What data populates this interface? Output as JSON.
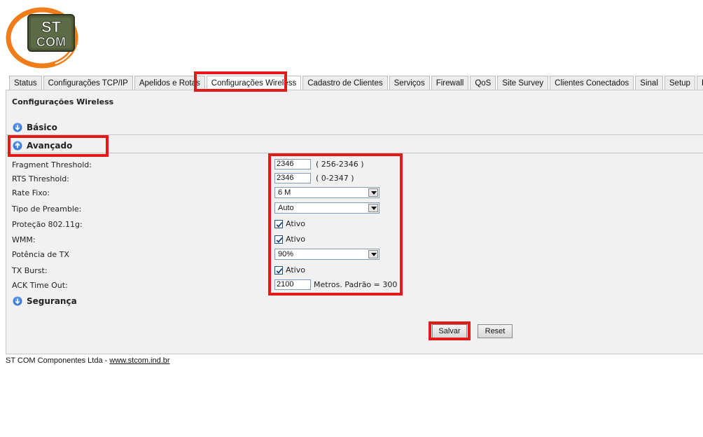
{
  "logo": {
    "line1": "ST",
    "line2": "COM",
    "ring_color": "#f07c1a",
    "box_color": "#4e5a3a"
  },
  "tabs": [
    {
      "label": "Status"
    },
    {
      "label": "Configurações TCP/IP"
    },
    {
      "label": "Apelidos e Rotas"
    },
    {
      "label": "Configurações Wireless",
      "active": true
    },
    {
      "label": "Cadastro de Clientes"
    },
    {
      "label": "Serviços"
    },
    {
      "label": "Firewall"
    },
    {
      "label": "QoS"
    },
    {
      "label": "Site Survey"
    },
    {
      "label": "Clientes Conectados"
    },
    {
      "label": "Sinal"
    },
    {
      "label": "Setup"
    },
    {
      "label": "Logout"
    }
  ],
  "page_title": "Configurações Wireless",
  "sections": {
    "basico": {
      "label": "Básico",
      "icon": "expand-down-icon"
    },
    "avancado": {
      "label": "Avançado",
      "icon": "collapse-up-icon"
    },
    "seguranca": {
      "label": "Segurança",
      "icon": "expand-down-icon"
    }
  },
  "fields": {
    "fragment_threshold": {
      "label": "Fragment Threshold:",
      "value": "2346",
      "hint": "( 256-2346 )"
    },
    "rts_threshold": {
      "label": "RTS Threshold:",
      "value": "2346",
      "hint": "( 0-2347 )"
    },
    "rate_fixo": {
      "label": "Rate Fixo:",
      "selected": "6 M"
    },
    "tipo_preamble": {
      "label": "Tipo de Preamble:",
      "selected": "Auto"
    },
    "protecao": {
      "label": "Proteção 802.11g:",
      "checked": true,
      "option_label": "Ativo"
    },
    "wmm": {
      "label": "WMM:",
      "checked": true,
      "option_label": "Ativo"
    },
    "potencia_tx": {
      "label": "Potência de TX",
      "selected": "90%"
    },
    "tx_burst": {
      "label": "TX Burst:",
      "checked": true,
      "option_label": "Ativo"
    },
    "ack_timeout": {
      "label": "ACK Time Out:",
      "value": "2100",
      "hint": "Metros. Padrão = 300"
    }
  },
  "buttons": {
    "save": "Salvar",
    "reset": "Reset"
  },
  "footer": {
    "company": "ST COM Componentes Ltda - ",
    "link": "www.stcom.ind.br"
  },
  "colors": {
    "highlight": "#e31a1a",
    "panel_bg": "#f1f1f1",
    "icon_blue": "#3b7dd8"
  }
}
